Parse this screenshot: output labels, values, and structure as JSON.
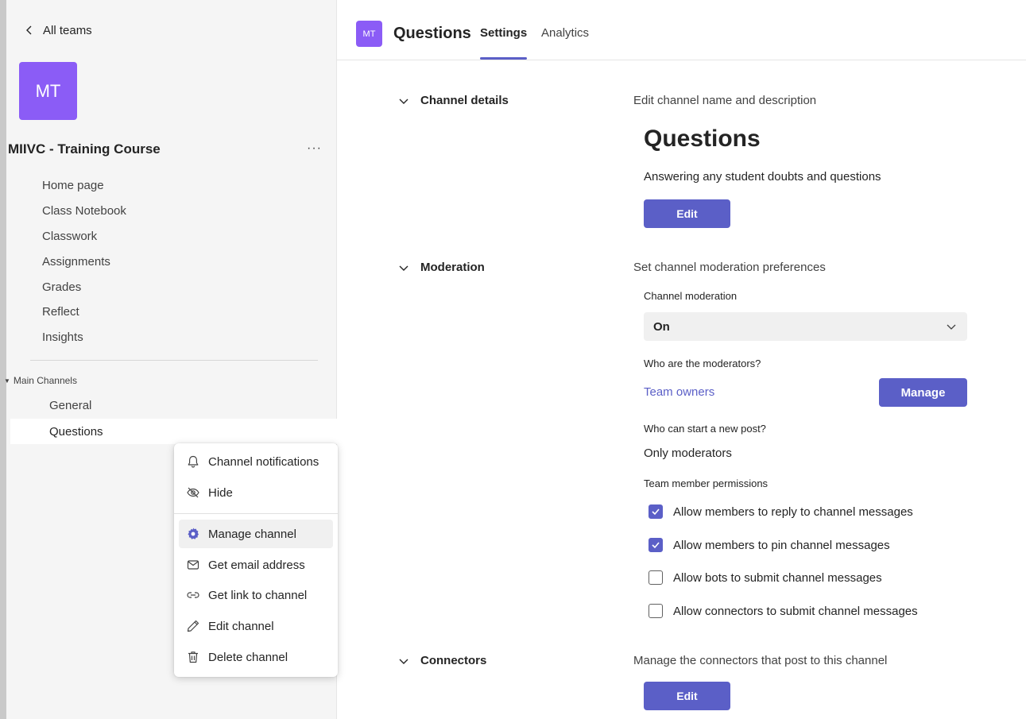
{
  "sidebar": {
    "back_label": "All teams",
    "team_initials": "MT",
    "team_name": "MIIVC - Training Course",
    "more_label": "···",
    "nav": [
      "Home page",
      "Class Notebook",
      "Classwork",
      "Assignments",
      "Grades",
      "Reflect",
      "Insights"
    ],
    "section_label": "Main Channels",
    "channels": [
      "General",
      "Questions"
    ]
  },
  "context_menu": {
    "items": [
      "Channel notifications",
      "Hide",
      "Manage channel",
      "Get email address",
      "Get link to channel",
      "Edit channel",
      "Delete channel"
    ]
  },
  "header": {
    "initials": "MT",
    "title": "Questions",
    "tabs": [
      "Settings",
      "Analytics"
    ]
  },
  "channel_details": {
    "heading": "Channel details",
    "description": "Edit channel name and description",
    "name": "Questions",
    "channel_description": "Answering any student doubts and questions",
    "edit_label": "Edit"
  },
  "moderation": {
    "heading": "Moderation",
    "description": "Set channel moderation preferences",
    "channel_moderation_label": "Channel moderation",
    "channel_moderation_value": "On",
    "moderators_label": "Who are the moderators?",
    "moderators_value": "Team owners",
    "manage_label": "Manage",
    "new_post_label": "Who can start a new post?",
    "new_post_value": "Only moderators",
    "permissions_label": "Team member permissions",
    "permissions": [
      {
        "label": "Allow members to reply to channel messages",
        "checked": true
      },
      {
        "label": "Allow members to pin channel messages",
        "checked": true
      },
      {
        "label": "Allow bots to submit channel messages",
        "checked": false
      },
      {
        "label": "Allow connectors to submit channel messages",
        "checked": false
      }
    ]
  },
  "connectors": {
    "heading": "Connectors",
    "description": "Manage the connectors that post to this channel",
    "edit_label": "Edit"
  },
  "colors": {
    "accent": "#5b5fc7",
    "avatar": "#8b5cf6"
  }
}
